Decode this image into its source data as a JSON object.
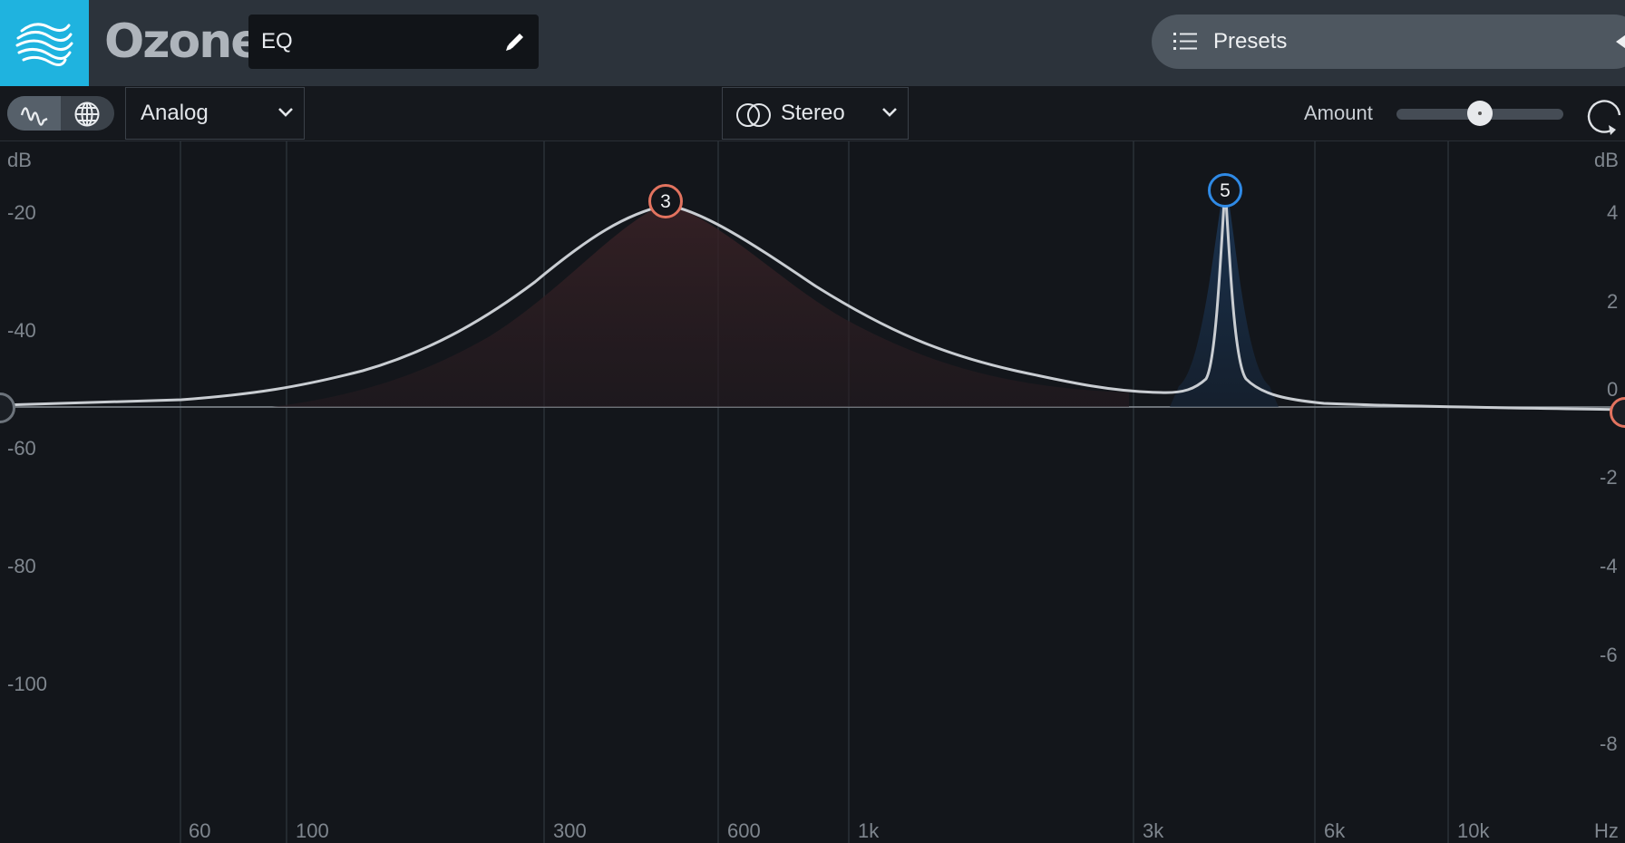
{
  "header": {
    "app_name": "Ozone",
    "module_name": "EQ",
    "presets_label": "Presets"
  },
  "toolbar": {
    "mode_value": "Analog",
    "channel_value": "Stereo",
    "amount_label": "Amount",
    "amount_value": 0.5
  },
  "graph": {
    "left_unit": "dB",
    "right_unit": "dB",
    "left_ticks": [
      "-20",
      "-40",
      "-60",
      "-80",
      "-100"
    ],
    "right_ticks": [
      "4",
      "2",
      "0",
      "-2",
      "-4",
      "-6",
      "-8"
    ],
    "freq_ticks": [
      "60",
      "100",
      "300",
      "600",
      "1k",
      "3k",
      "6k",
      "10k"
    ],
    "freq_unit": "Hz",
    "bands": [
      {
        "label": "3",
        "color": "#e2735f"
      },
      {
        "label": "5",
        "color": "#2f8ae6"
      }
    ]
  },
  "colors": {
    "accent": "#1fb3df",
    "band3": "#e2735f",
    "band5": "#2f8ae6"
  }
}
